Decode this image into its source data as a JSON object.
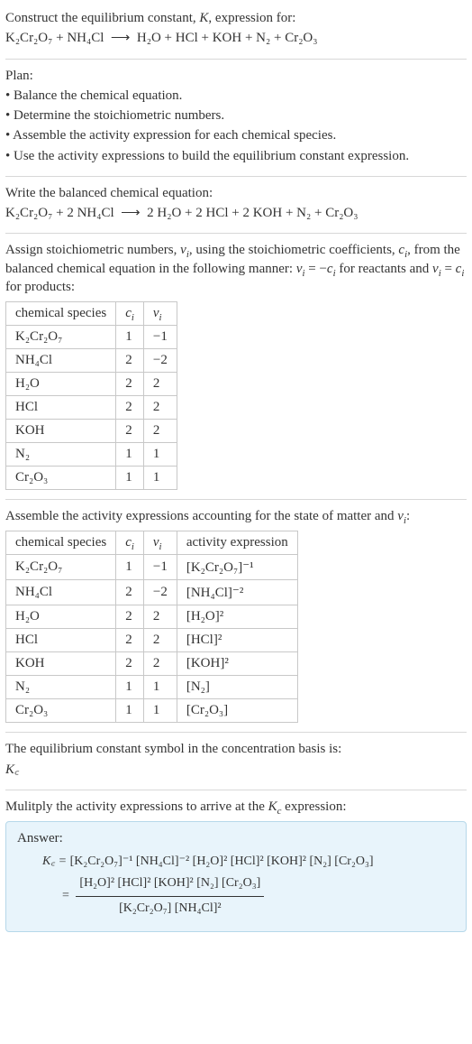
{
  "intro": {
    "line1_pre": "Construct the equilibrium constant, ",
    "line1_post": ", expression for:",
    "reaction_lhs": "K₂Cr₂O₇ + NH₄Cl",
    "reaction_arrow": "⟶",
    "reaction_rhs": "H₂O + HCl + KOH + N₂ + Cr₂O₃"
  },
  "plan": {
    "heading": "Plan:",
    "b1": "• Balance the chemical equation.",
    "b2": "• Determine the stoichiometric numbers.",
    "b3": "• Assemble the activity expression for each chemical species.",
    "b4": "• Use the activity expressions to build the equilibrium constant expression."
  },
  "balanced": {
    "heading": "Write the balanced chemical equation:",
    "lhs": "K₂Cr₂O₇ + 2 NH₄Cl",
    "arrow": "⟶",
    "rhs": "2 H₂O + 2 HCl + 2 KOH + N₂ + Cr₂O₃"
  },
  "stoich_text": {
    "pre": "Assign stoichiometric numbers, ",
    "mid1": ", using the stoichiometric coefficients, ",
    "mid2": ", from the balanced chemical equation in the following manner: ",
    "eq_reactants": " = −",
    "post_reactants": " for reactants and ",
    "eq_products": " = ",
    "post_products": " for products:"
  },
  "table1": {
    "h_species": "chemical species",
    "h_ci": "cᵢ",
    "h_vi": "νᵢ",
    "rows": [
      {
        "species": "K₂Cr₂O₇",
        "c": "1",
        "v": "−1"
      },
      {
        "species": "NH₄Cl",
        "c": "2",
        "v": "−2"
      },
      {
        "species": "H₂O",
        "c": "2",
        "v": "2"
      },
      {
        "species": "HCl",
        "c": "2",
        "v": "2"
      },
      {
        "species": "KOH",
        "c": "2",
        "v": "2"
      },
      {
        "species": "N₂",
        "c": "1",
        "v": "1"
      },
      {
        "species": "Cr₂O₃",
        "c": "1",
        "v": "1"
      }
    ]
  },
  "activity_text": {
    "pre": "Assemble the activity expressions accounting for the state of matter and ",
    "post": ":"
  },
  "table2": {
    "h_species": "chemical species",
    "h_ci": "cᵢ",
    "h_vi": "νᵢ",
    "h_activity": "activity expression",
    "rows": [
      {
        "species": "K₂Cr₂O₇",
        "c": "1",
        "v": "−1",
        "act": "[K₂Cr₂O₇]⁻¹"
      },
      {
        "species": "NH₄Cl",
        "c": "2",
        "v": "−2",
        "act": "[NH₄Cl]⁻²"
      },
      {
        "species": "H₂O",
        "c": "2",
        "v": "2",
        "act": "[H₂O]²"
      },
      {
        "species": "HCl",
        "c": "2",
        "v": "2",
        "act": "[HCl]²"
      },
      {
        "species": "KOH",
        "c": "2",
        "v": "2",
        "act": "[KOH]²"
      },
      {
        "species": "N₂",
        "c": "1",
        "v": "1",
        "act": "[N₂]"
      },
      {
        "species": "Cr₂O₃",
        "c": "1",
        "v": "1",
        "act": "[Cr₂O₃]"
      }
    ]
  },
  "symbol_text": {
    "line": "The equilibrium constant symbol in the concentration basis is:",
    "kc": "K꜀"
  },
  "multiply": {
    "pre": "Mulitply the activity expressions to arrive at the ",
    "post": " expression:"
  },
  "answer": {
    "title": "Answer:",
    "kc_eq": "K꜀ = ",
    "flat": "[K₂Cr₂O₇]⁻¹ [NH₄Cl]⁻² [H₂O]² [HCl]² [KOH]² [N₂] [Cr₂O₃]",
    "eq2": "= ",
    "num": "[H₂O]² [HCl]² [KOH]² [N₂] [Cr₂O₃]",
    "den": "[K₂Cr₂O₇] [NH₄Cl]²"
  }
}
